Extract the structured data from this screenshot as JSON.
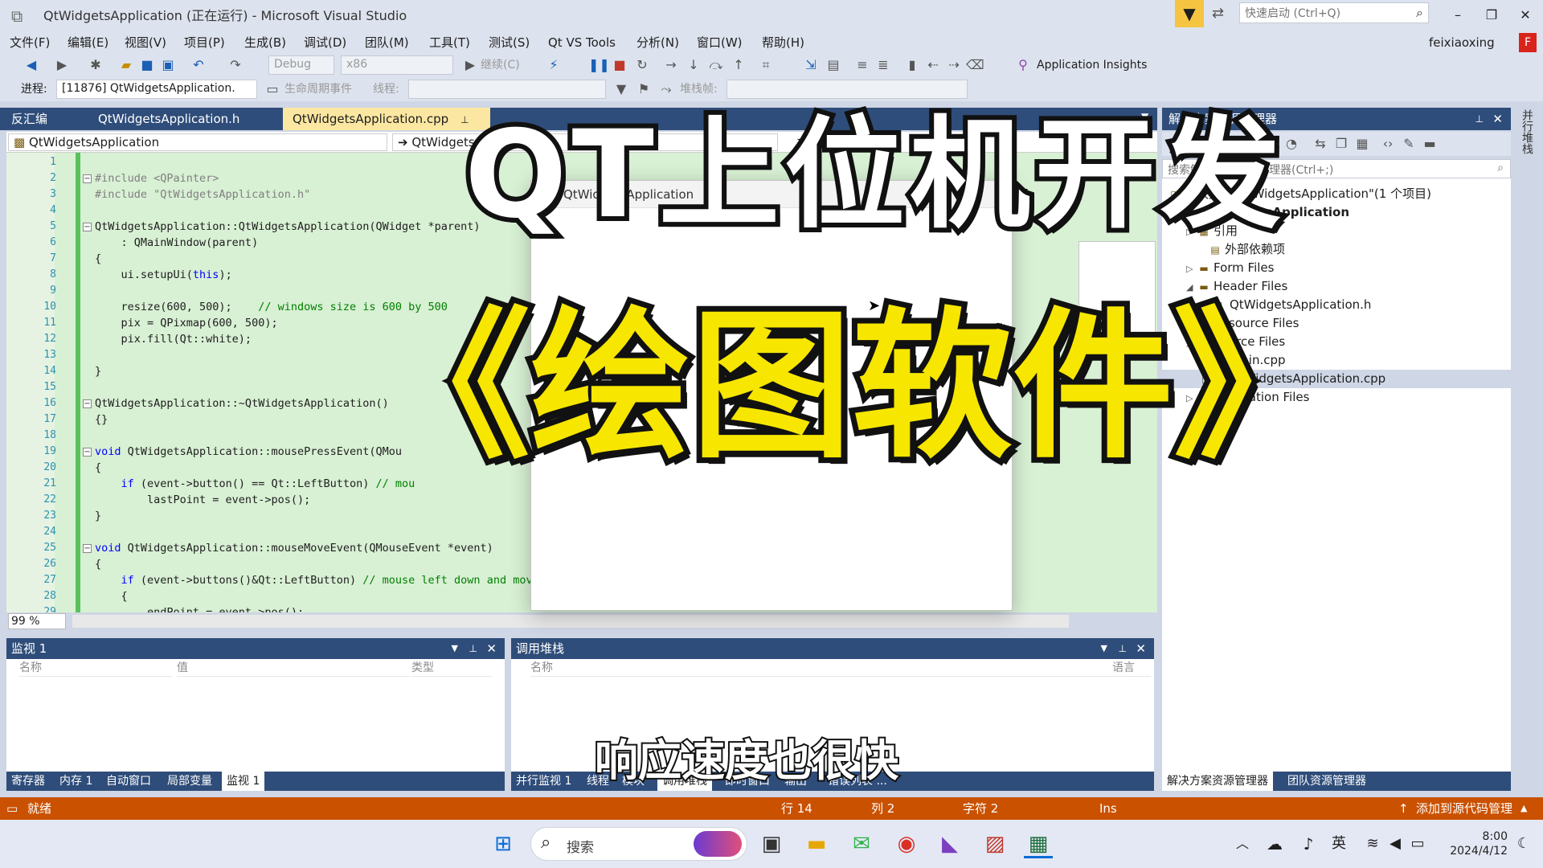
{
  "window": {
    "title": "QtWidgetsApplication (正在运行) - Microsoft Visual Studio",
    "quick_launch_placeholder": "快速启动 (Ctrl+Q)",
    "user_name": "feixiaoxing",
    "user_initial": "F"
  },
  "menu": [
    "文件(F)",
    "编辑(E)",
    "视图(V)",
    "项目(P)",
    "生成(B)",
    "调试(D)",
    "团队(M)",
    "工具(T)",
    "测试(S)",
    "Qt VS Tools",
    "分析(N)",
    "窗口(W)",
    "帮助(H)"
  ],
  "toolbar": {
    "config": "Debug",
    "platform": "x86",
    "continue": "继续(C)",
    "app_insights": "Application Insights"
  },
  "debug_toolbar": {
    "process_label": "进程:",
    "process_value": "[11876] QtWidgetsApplication.",
    "lifecycle_label": "生命周期事件",
    "thread_label": "线程:",
    "stackframe_label": "堆栈帧:"
  },
  "doc_tabs": [
    {
      "label": "反汇编",
      "active": false
    },
    {
      "label": "QtWidgetsApplication.h",
      "active": false
    },
    {
      "label": "QtWidgetsApplication.cpp",
      "active": true
    }
  ],
  "nav": {
    "scope": "QtWidgetsApplication",
    "member": "QtWidgetsA"
  },
  "editor": {
    "zoom": "99 %",
    "line_numbers": [
      "1",
      "2",
      "3",
      "4",
      "5",
      "6",
      "7",
      "8",
      "9",
      "10",
      "11",
      "12",
      "13",
      "14",
      "15",
      "16",
      "17",
      "18",
      "19",
      "20",
      "21",
      "22",
      "23",
      "24",
      "25",
      "26",
      "27",
      "28",
      "29"
    ],
    "lines": [
      "",
      "#include <QPainter>",
      "#include \"QtWidgetsApplication.h\"",
      "",
      "QtWidgetsApplication::QtWidgetsApplication(QWidget *parent)",
      "    : QMainWindow(parent)",
      "{",
      "    ui.setupUi(this);",
      "",
      "    resize(600, 500);    // windows size is 600 by 500",
      "    pix = QPixmap(600, 500);",
      "    pix.fill(Qt::white);",
      "",
      "}",
      "",
      "QtWidgetsApplication::~QtWidgetsApplication()",
      "{}",
      "",
      "void QtWidgetsApplication::mousePressEvent(QMou",
      "{",
      "    if (event->button() == Qt::LeftButton) // mou",
      "        lastPoint = event->pos();",
      "}",
      "",
      "void QtWidgetsApplication::mouseMoveEvent(QMouseEvent *event)",
      "{",
      "    if (event->buttons()&Qt::LeftButton) // mouse left down and move",
      "    {",
      "        endPoint = event->pos();"
    ]
  },
  "running_app": {
    "title": "QtWidgetsApplication"
  },
  "solution_explorer": {
    "title": "解决方案资源管理器",
    "search_placeholder": "搜索解决方案资源管理器(Ctrl+;)",
    "items": [
      "解决方案\"QtWidgetsApplication\"(1 个项目)",
      "QtWidgetsApplication",
      "引用",
      "外部依赖项",
      "Form Files",
      "Header Files",
      "QtWidgetsApplication.h",
      "Resource Files",
      "Source Files",
      "main.cpp",
      "QtWidgetsApplication.cpp",
      "Translation Files"
    ],
    "bottom_tabs": [
      "解决方案资源管理器",
      "团队资源管理器"
    ],
    "side_strip": "并行堆栈"
  },
  "watch": {
    "title": "监视 1",
    "columns": [
      "名称",
      "值",
      "类型"
    ],
    "tabs": [
      "寄存器",
      "内存 1",
      "自动窗口",
      "局部变量",
      "监视 1"
    ]
  },
  "callstack": {
    "title": "调用堆栈",
    "columns": [
      "名称",
      "语言"
    ],
    "tabs": [
      "并行监视 1",
      "线程",
      "模块",
      "调用堆栈",
      "即时窗口",
      "输出",
      "错误列表 ..."
    ]
  },
  "status": {
    "ready": "就绪",
    "line": "行 14",
    "col": "列 2",
    "char": "字符 2",
    "ins": "Ins",
    "source_control": "添加到源代码管理"
  },
  "taskbar": {
    "search_placeholder": "搜索",
    "ime": "英",
    "time": "8:00",
    "date": "2024/4/12"
  },
  "overlay": {
    "title": "QT上位机开发",
    "subtitle": "《绘图软件》",
    "caption": "响应速度也很快"
  }
}
